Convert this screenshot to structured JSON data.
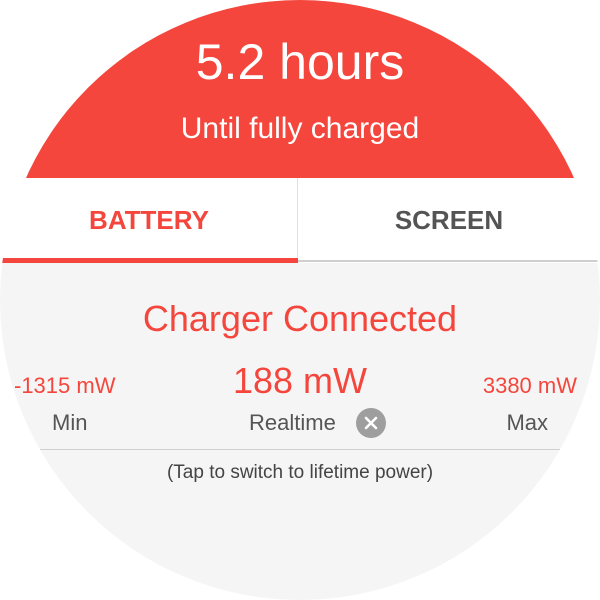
{
  "header": {
    "time_remaining": "5.2 hours",
    "subtitle": "Until fully charged",
    "color": "#f4463c"
  },
  "tabs": [
    {
      "label": "BATTERY",
      "selected": true
    },
    {
      "label": "SCREEN",
      "selected": false
    }
  ],
  "status": {
    "text": "Charger Connected"
  },
  "stats": {
    "min": {
      "value": "-1315 mW",
      "label": "Min"
    },
    "realtime": {
      "value": "188 mW",
      "label": "Realtime"
    },
    "max": {
      "value": "3380 mW",
      "label": "Max"
    }
  },
  "icons": {
    "clear": "close-circle-icon"
  },
  "hint": "(Tap to switch to lifetime power)",
  "colors": {
    "accent": "#f4463c",
    "background": "#f5f5f5",
    "inactive_text": "#545454"
  }
}
